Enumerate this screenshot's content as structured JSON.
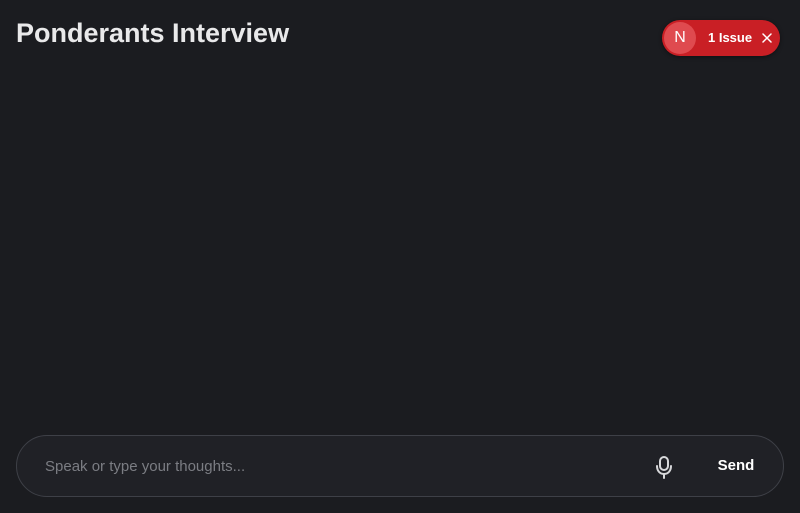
{
  "header": {
    "title": "Ponderants Interview"
  },
  "issue_badge": {
    "logo_letter": "N",
    "text": "1 Issue",
    "close_icon": "close-icon",
    "color": "#c91f25"
  },
  "composer": {
    "placeholder": "Speak or type your thoughts...",
    "value": "",
    "mic_icon": "microphone-icon",
    "send_label": "Send"
  },
  "colors": {
    "background": "#1b1c20",
    "composer_border": "#3e4047",
    "text": "#e9e9ea"
  }
}
